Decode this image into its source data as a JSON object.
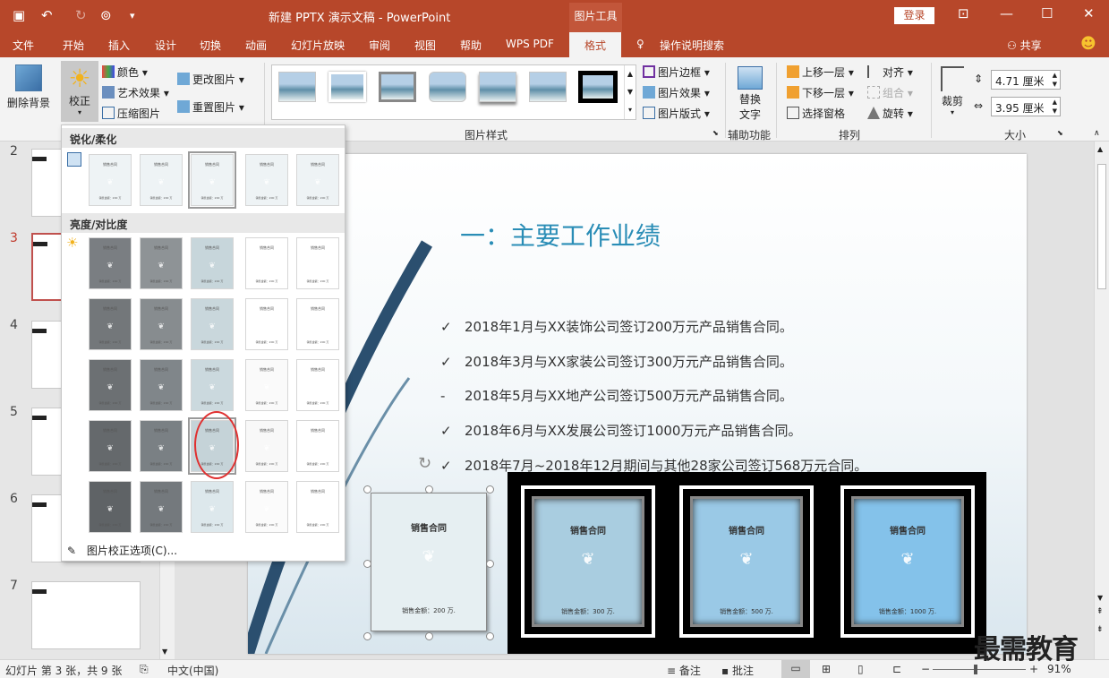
{
  "window": {
    "title": "新建 PPTX 演示文稿  -  PowerPoint",
    "context_tab": "图片工具",
    "login": "登录"
  },
  "menu": [
    "文件",
    "开始",
    "插入",
    "设计",
    "切换",
    "动画",
    "幻灯片放映",
    "审阅",
    "视图",
    "帮助",
    "WPS PDF",
    "格式"
  ],
  "menu_active": "格式",
  "tell_me": "操作说明搜索",
  "share": "共享",
  "ribbon": {
    "remove_bg": "删除背景",
    "corrections": "校正",
    "color": "颜色",
    "artistic": "艺术效果",
    "compress": "压缩图片",
    "change_pic": "更改图片",
    "reset_pic": "重置图片",
    "border": "图片边框",
    "effects": "图片效果",
    "layout": "图片版式",
    "styles_group": "图片样式",
    "alt_text_line1": "替换",
    "alt_text_line2": "文字",
    "access_group": "辅助功能",
    "bring_forward": "上移一层",
    "send_backward": "下移一层",
    "selection_pane": "选择窗格",
    "align": "对齐",
    "group": "组合",
    "rotate": "旋转",
    "arrange_group": "排列",
    "crop": "裁剪",
    "height": "4.71 厘米",
    "width": "3.95 厘米",
    "size_group": "大小"
  },
  "dropdown": {
    "sharpen_header": "锐化/柔化",
    "brightness_header": "亮度/对比度",
    "options": "图片校正选项(C)...",
    "cell_title": "销售合同",
    "cell_foot": "销售金额：200 万"
  },
  "slides": [
    {
      "num": "2"
    },
    {
      "num": "3",
      "active": true
    },
    {
      "num": "4"
    },
    {
      "num": "5"
    },
    {
      "num": "6"
    },
    {
      "num": "7"
    }
  ],
  "slide": {
    "title": "一：主要工作业绩",
    "bullets": [
      {
        "mark": "✓",
        "text": "2018年1月与XX装饰公司签订200万元产品销售合同。"
      },
      {
        "mark": "✓",
        "text": "2018年3月与XX家装公司签订300万元产品销售合同。"
      },
      {
        "mark": "-",
        "text": "2018年5月与XX地产公司签订500万元产品销售合同。"
      },
      {
        "mark": "✓",
        "text": "2018年6月与XX发展公司签订1000万元产品销售合同。"
      },
      {
        "mark": "✓",
        "text": "2018年7月~2018年12月期间与其他28家公司签订568万元合同。"
      }
    ],
    "docs": [
      {
        "title": "销售合同",
        "foot": "销售金额：200 万."
      },
      {
        "title": "销售合同",
        "foot": "销售金额：300 万."
      },
      {
        "title": "销售合同",
        "foot": "销售金额：500 万."
      },
      {
        "title": "销售合同",
        "foot": "销售金额：1000 万."
      }
    ]
  },
  "status": {
    "slide_info": "幻灯片 第 3 张，共 9 张",
    "lang": "中文(中国)",
    "notes": "备注",
    "comments": "批注",
    "zoom": "91%"
  },
  "watermark": "最需教育",
  "colors": {
    "accent": "#b7472a",
    "title_blue": "#2a8db6",
    "highlight_red": "#e03030"
  }
}
